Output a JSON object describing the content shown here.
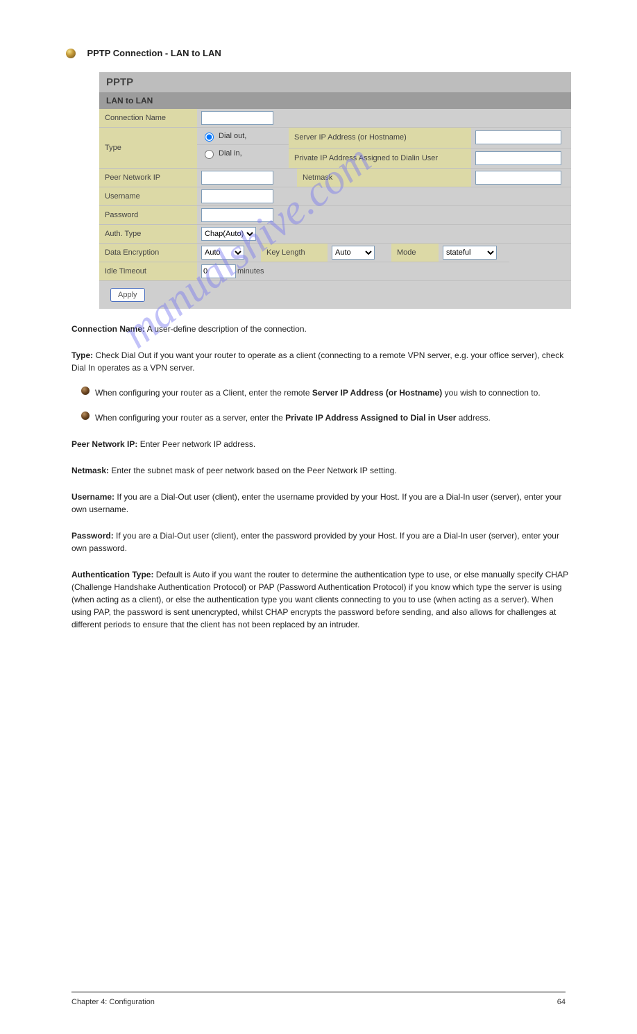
{
  "heading": {
    "mode": "PPTP Connection - LAN to LAN"
  },
  "panel": {
    "title": "PPTP",
    "subtitle": "LAN to LAN",
    "labels": {
      "connection_name": "Connection Name",
      "type": "Type",
      "dial_out": "Dial out,",
      "dial_in": "Dial in,",
      "server_ip": "Server IP Address (or Hostname)",
      "private_ip": "Private IP Address Assigned to Dialin User",
      "peer_ip": "Peer Network IP",
      "netmask": "Netmask",
      "username": "Username",
      "password": "Password",
      "auth_type": "Auth. Type",
      "data_enc": "Data Encryption",
      "key_length": "Key Length",
      "mode": "Mode",
      "idle_timeout": "Idle Timeout",
      "idle_suffix": "minutes",
      "apply": "Apply"
    },
    "values": {
      "connection_name": "",
      "server_ip": "",
      "private_ip": "",
      "peer_ip": "",
      "netmask": "",
      "username": "",
      "password": "",
      "auth_type": "Chap(Auto)",
      "data_enc": "Auto",
      "key_length": "Auto",
      "mode_sel": "stateful",
      "idle_timeout": "0"
    }
  },
  "doc": {
    "conn_name": "Connection Name:",
    "conn_name_after": " A user-define description of the connection.",
    "type": "Type: ",
    "type_after": "Check Dial Out if you want your router to operate as a client (connecting to a remote VPN server, e.g. your office server), check Dial In operates as a VPN server.",
    "dial_out_pre": "When configuring your router as a Client, enter the remote ",
    "dial_out_bold": "Server IP Address (or Hostname)",
    "dial_out_post": " you wish to connection to.",
    "dial_in_pre": "When configuring your router as a server, enter the ",
    "dial_in_bold": "Private IP Address Assigned to Dial in User",
    "dial_in_post": " address.",
    "peer_bold": "Peer Network IP: ",
    "peer_after": "Enter Peer network IP address.",
    "netmask_bold": "Netmask: ",
    "netmask_after": "Enter the subnet mask of peer network based on the Peer Network IP setting.",
    "user_bold": "Username: ",
    "user_after": "If you are a Dial-Out user (client), enter the username provided by your Host.  If you are a Dial-In user (server), enter your own username.",
    "pass_bold": "Password: ",
    "pass_after": "If you are a Dial-Out user (client), enter the password provided by your Host.  If you are a Dial-In user (server), enter your own password.",
    "auth_bold": "Authentication Type:",
    "auth_after": " Default is Auto if you want the router to determine the authentication type to use, or else manually specify CHAP (Challenge Handshake Authentication Protocol) or PAP (Password Authentication Protocol) if you know which type the server is using (when acting as a client), or else the authentication type you want clients connecting to you to use (when acting as a server).  When using PAP, the password is sent unencrypted, whilst CHAP encrypts the password before sending, and also allows for challenges at different periods to ensure that the client has not been replaced by an intruder."
  },
  "footer": {
    "left": "Chapter 4: Configuration",
    "right": "64"
  },
  "watermark": "manualshive.com"
}
